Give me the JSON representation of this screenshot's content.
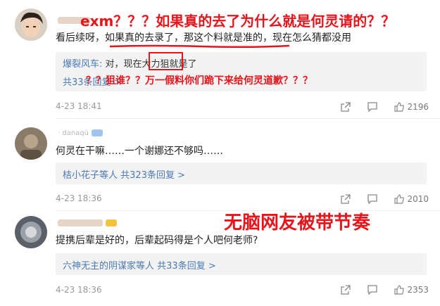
{
  "comments": [
    {
      "body": "看后续呀，如果真的去录了，那这个料就是准的，现在怎么猜都没用",
      "reply": {
        "author": "爆裂风车:",
        "text": " 对，现在大力狙就是了",
        "more": "共33条回复 >"
      },
      "time": "4-23 18:41",
      "likes": "2196"
    },
    {
      "username": "· danaqü",
      "body": "何灵在干嘛……一个谢娜还不够吗……",
      "reply": {
        "users": "桔小花子等人",
        "count": "共323条回复 >"
      },
      "time": "4-23 18:36",
      "likes": "2010"
    },
    {
      "body": "提携后辈是好的，后辈起码得是个人吧何老师?",
      "reply": {
        "users": "六神无主的阴谋家等人",
        "count": "共33条回复 >"
      },
      "time": "4-23 18:36",
      "likes": "2353"
    }
  ],
  "annotations": {
    "top": "exm？？？如果真的去了为什么就是何灵请的？？",
    "middle": "？？狙谁？？万一假料你们跪下来给何灵道歉？？？",
    "big": "无脑网友被带节奏"
  },
  "colors": {
    "annotation": "#e8141b",
    "link": "#4a79b5",
    "reply_bg": "#f3f3f3"
  },
  "icons": [
    "share-icon",
    "comment-icon",
    "like-icon"
  ]
}
